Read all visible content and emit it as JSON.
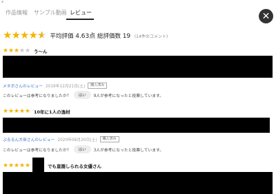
{
  "corner_mark": "x",
  "tabs": [
    {
      "label": "作品情報",
      "active": false
    },
    {
      "label": "サンプル動画",
      "active": false
    },
    {
      "label": "レビュー",
      "active": true
    }
  ],
  "close_icon": "✕",
  "summary": {
    "star_icon": "★",
    "rating_value": 4.63,
    "label_avg": "平均評価",
    "avg": "4.63点",
    "label_total": "総評価数",
    "total": "19",
    "comments": "(14件のコメント)"
  },
  "reviews": [
    {
      "rating": 3,
      "title": "う～ん",
      "author": "メタボさんのレビュー",
      "date": "2019年12月21日(土)",
      "badge": "購入済み",
      "helpful_question": "このレビューは参考になりましたか？",
      "yes_label": "はい",
      "helpful_count": "9人が参考になったと投票しています。"
    },
    {
      "rating": 5,
      "title": "10年に1人の逸材",
      "author": "ぷるるん大帝さんのレビュー",
      "date": "2020年06月20日(土)",
      "badge": "購入済み",
      "helpful_question": "このレビューは参考になりましたか？",
      "yes_label": "はい",
      "helpful_count": "3人が参考になったと投票しています。"
    },
    {
      "rating": 5,
      "title": "でも直隠しられる女優さん"
    }
  ],
  "colors": {
    "star": "#f5b400",
    "star_off": "#c8c8c8",
    "author_link": "#3a72c8"
  }
}
